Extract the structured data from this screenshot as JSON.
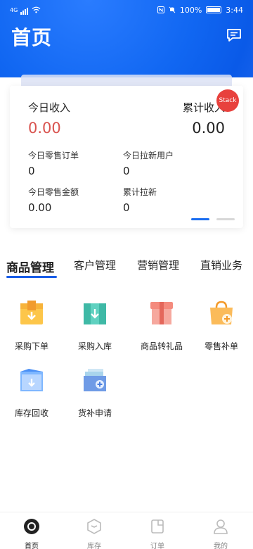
{
  "status_bar": {
    "network": "4G",
    "battery": "100%",
    "time": "3:44"
  },
  "header": {
    "title": "首页",
    "message_icon": "message-icon"
  },
  "revenue_card": {
    "today_label": "今日收入",
    "today_value": "0.00",
    "total_label": "累计收入",
    "total_value": "0.00",
    "badge": "Stack",
    "stats": [
      {
        "label": "今日零售订单",
        "value": "0"
      },
      {
        "label": "今日拉新用户",
        "value": "0"
      },
      {
        "label": "今日零售金额",
        "value": "0.00"
      },
      {
        "label": "累计拉新",
        "value": "0"
      }
    ]
  },
  "tabs": [
    "商品管理",
    "客户管理",
    "营销管理",
    "直销业务"
  ],
  "active_tab": "商品管理",
  "grid": [
    {
      "label": "采购下单",
      "icon": "purchase-order-icon"
    },
    {
      "label": "采购入库",
      "icon": "purchase-inbound-icon"
    },
    {
      "label": "商品转礼品",
      "icon": "gift-convert-icon"
    },
    {
      "label": "零售补单",
      "icon": "retail-supplement-icon"
    },
    {
      "label": "库存回收",
      "icon": "inventory-recycle-icon"
    },
    {
      "label": "货补申请",
      "icon": "replenish-apply-icon"
    }
  ],
  "bottom_nav": [
    {
      "label": "首页",
      "icon": "home-icon",
      "active": true
    },
    {
      "label": "库存",
      "icon": "inventory-icon",
      "active": false
    },
    {
      "label": "订单",
      "icon": "order-icon",
      "active": false
    },
    {
      "label": "我的",
      "icon": "profile-icon",
      "active": false
    }
  ],
  "colors": {
    "brand_blue": "#1167f2",
    "revenue_red": "#d9534f",
    "badge_red": "#e8413d",
    "tab_underline": "#1a5ee8"
  }
}
